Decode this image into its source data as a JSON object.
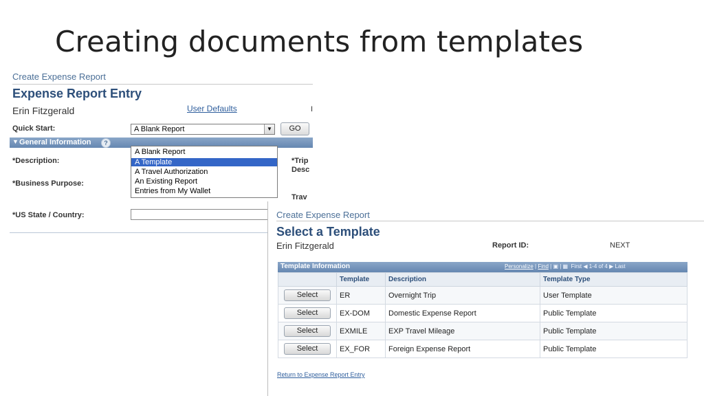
{
  "slide": {
    "title": "Creating documents from templates"
  },
  "entry": {
    "breadcrumb": "Create Expense Report",
    "heading": "Expense Report Entry",
    "user": "Erin Fitzgerald",
    "user_defaults_link": "User Defaults",
    "quick_start_label": "Quick Start:",
    "quick_start_value": "A Blank Report",
    "go_label": "GO",
    "section_title": "General Information",
    "help_glyph": "?",
    "dropdown_options": [
      "A Blank Report",
      "A Template",
      "A Travel Authorization",
      "An Existing Report",
      "Entries from My Wallet"
    ],
    "selected_option": "A Template",
    "description_label": "*Description:",
    "business_purpose_label": "*Business Purpose:",
    "us_state_label": "*US State / Country:",
    "trip_label": "*Trip",
    "trip_label_2": "Desc",
    "travel_label": "Trav",
    "right_edge_label": "I"
  },
  "template": {
    "breadcrumb": "Create Expense Report",
    "heading": "Select a Template",
    "user": "Erin Fitzgerald",
    "report_id_label": "Report ID:",
    "report_id_value": "NEXT",
    "grid_title": "Template Information",
    "personalize_link": "Personalize",
    "find_link": "Find",
    "first_label": "First",
    "range_label": "1-4 of 4",
    "last_label": "Last",
    "columns": [
      "Template",
      "Description",
      "Template Type"
    ],
    "select_label": "Select",
    "rows": [
      {
        "template": "ER",
        "description": "Overnight Trip",
        "type": "User Template"
      },
      {
        "template": "EX-DOM",
        "description": "Domestic Expense Report",
        "type": "Public Template"
      },
      {
        "template": "EXMILE",
        "description": "EXP Travel Mileage",
        "type": "Public Template"
      },
      {
        "template": "EX_FOR",
        "description": "Foreign Expense Report",
        "type": "Public Template"
      }
    ],
    "return_link": "Return to Expense Report Entry"
  }
}
